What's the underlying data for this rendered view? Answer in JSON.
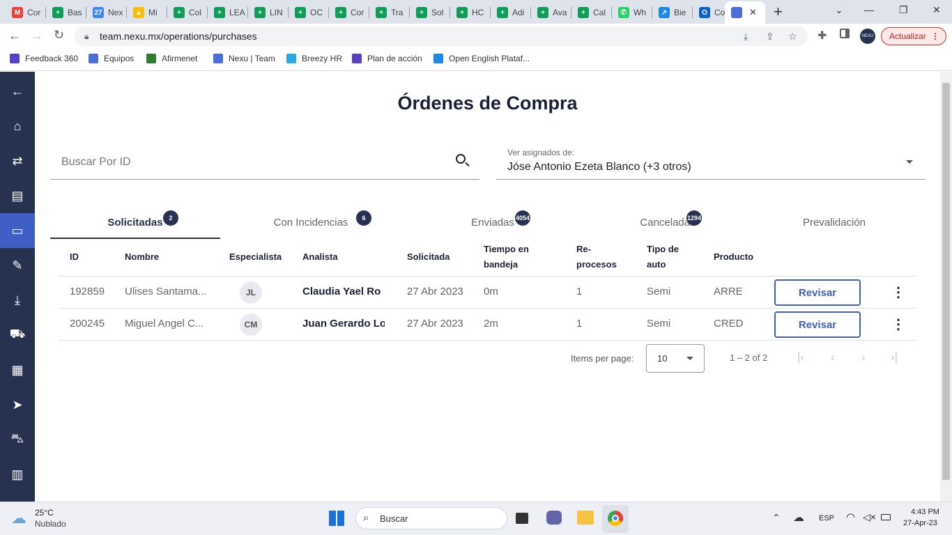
{
  "browser": {
    "tabs": [
      {
        "label": "Cor",
        "color": "#ea4335",
        "glyph": "M"
      },
      {
        "label": "Bas",
        "color": "#0f9d58",
        "glyph": "+"
      },
      {
        "label": "Nex",
        "color": "#4285f4",
        "glyph": "27"
      },
      {
        "label": "Mi",
        "color": "#fbbc04",
        "glyph": "▲"
      },
      {
        "label": "Col",
        "color": "#0f9d58",
        "glyph": "+"
      },
      {
        "label": "LEA",
        "color": "#0f9d58",
        "glyph": "+"
      },
      {
        "label": "LIN",
        "color": "#0f9d58",
        "glyph": "+"
      },
      {
        "label": "OC",
        "color": "#0f9d58",
        "glyph": "+"
      },
      {
        "label": "Cor",
        "color": "#0f9d58",
        "glyph": "+"
      },
      {
        "label": "Tra",
        "color": "#0f9d58",
        "glyph": "+"
      },
      {
        "label": "Sol",
        "color": "#0f9d58",
        "glyph": "+"
      },
      {
        "label": "HC",
        "color": "#0f9d58",
        "glyph": "+"
      },
      {
        "label": "Adi",
        "color": "#0f9d58",
        "glyph": "+"
      },
      {
        "label": "Ava",
        "color": "#0f9d58",
        "glyph": "+"
      },
      {
        "label": "Cal",
        "color": "#0f9d58",
        "glyph": "+"
      },
      {
        "label": "Wh",
        "color": "#25d366",
        "glyph": "✆"
      },
      {
        "label": "Bie",
        "color": "#1e88e5",
        "glyph": "↗"
      },
      {
        "label": "Cor",
        "color": "#0a64c8",
        "glyph": "O"
      }
    ],
    "active_tab_glyph": "✕",
    "new_tab": "+",
    "url": "team.nexu.mx/operations/purchases",
    "update_button": "Actualizar",
    "profile": "NEXU",
    "bookmarks": [
      {
        "label": "Feedback 360",
        "color": "#5b3fc6"
      },
      {
        "label": "Equipos",
        "color": "#4a6fd8"
      },
      {
        "label": "Afirmenet",
        "color": "#2e7d32"
      },
      {
        "label": "Nexu | Team",
        "color": "#4a6fd8"
      },
      {
        "label": "Breezy HR",
        "color": "#29a9e1"
      },
      {
        "label": "Plan de acción",
        "color": "#5b3fc6"
      },
      {
        "label": "Open English Plataf...",
        "color": "#1e88e5"
      }
    ]
  },
  "sidebar": {
    "icons": [
      "arrow-left-icon",
      "home-icon",
      "swap-icon",
      "book-icon",
      "money-icon",
      "edit-icon",
      "hand-icon",
      "car-crash-icon",
      "document-icon",
      "send-icon",
      "car-icon",
      "receipt-icon"
    ],
    "glyphs": [
      "←",
      "⌂",
      "⇄",
      "▤",
      "▭",
      "✎",
      "⤓",
      "⛟",
      "▦",
      "➤",
      "⛍",
      "▥"
    ]
  },
  "page": {
    "title": "Órdenes de Compra",
    "search_placeholder": "Buscar Por ID",
    "assigned_label": "Ver asignados de:",
    "assigned_value": "Jóse Antonio Ezeta Blanco (+3 otros)",
    "tabs": [
      {
        "label": "Solicitadas",
        "badge": "2"
      },
      {
        "label": "Con Incidencias",
        "badge": "6"
      },
      {
        "label": "Enviadas",
        "badge": "4054"
      },
      {
        "label": "Canceladas",
        "badge": "1294"
      },
      {
        "label": "Prevalidación",
        "badge": ""
      }
    ],
    "columns": {
      "id": "ID",
      "nombre": "Nombre",
      "especialista": "Especialista",
      "analista": "Analista",
      "solicitada": "Solicitada",
      "tiempo_1": "Tiempo en",
      "tiempo_2": "bandeja",
      "re_1": "Re-",
      "re_2": "procesos",
      "tipo_1": "Tipo de",
      "tipo_2": "auto",
      "producto": "Producto"
    },
    "rows": [
      {
        "id": "192859",
        "nombre": "Ulises Santama...",
        "especialista": "JL",
        "analista": "Claudia Yael Ro",
        "solicitada": "27 Abr 2023",
        "tiempo": "0m",
        "reprocesos": "1",
        "tipo": "Semi",
        "producto": "ARRE",
        "action": "Revisar"
      },
      {
        "id": "200245",
        "nombre": "Miguel Angel C...",
        "especialista": "CM",
        "analista": "Juan Gerardo Lo",
        "solicitada": "27 Abr 2023",
        "tiempo": "2m",
        "reprocesos": "1",
        "tipo": "Semi",
        "producto": "CRED",
        "action": "Revisar"
      }
    ],
    "paginator": {
      "items_label": "Items per page:",
      "page_size": "10",
      "range": "1 – 2 of 2"
    }
  },
  "taskbar": {
    "weather_temp": "25°C",
    "weather_desc": "Nublado",
    "search": "Buscar",
    "lang": "ESP",
    "time": "4:43 PM",
    "date": "27-Apr-23"
  },
  "colors": {
    "accent": "#3f5fc6",
    "sidebar": "#26324f",
    "title": "#1a2038"
  }
}
